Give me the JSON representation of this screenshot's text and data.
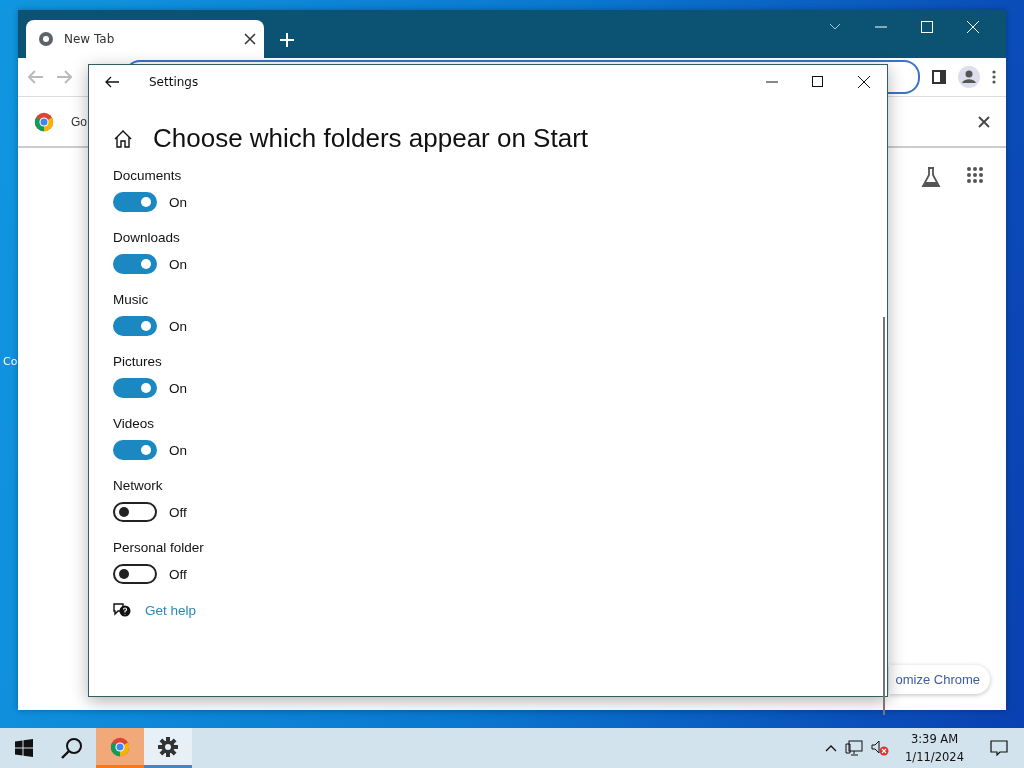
{
  "desktop": {
    "icon_label": "Co"
  },
  "browser": {
    "tabs": [
      {
        "title": "New Tab",
        "selected": true
      }
    ],
    "infobar_text": "Go",
    "customize_button": "omize Chrome"
  },
  "settings": {
    "title": "Settings",
    "heading": "Choose which folders appear on Start",
    "folders": [
      {
        "name": "Documents",
        "on": true,
        "state_label": "On"
      },
      {
        "name": "Downloads",
        "on": true,
        "state_label": "On"
      },
      {
        "name": "Music",
        "on": true,
        "state_label": "On"
      },
      {
        "name": "Pictures",
        "on": true,
        "state_label": "On"
      },
      {
        "name": "Videos",
        "on": true,
        "state_label": "On"
      },
      {
        "name": "Network",
        "on": false,
        "state_label": "Off"
      },
      {
        "name": "Personal folder",
        "on": false,
        "state_label": "Off"
      }
    ],
    "help_link": "Get help"
  },
  "taskbar": {
    "apps": [
      {
        "kind": "chrome",
        "selected": false,
        "flashing": true
      },
      {
        "kind": "settings",
        "selected": true,
        "flashing": false
      }
    ],
    "time": "3:39 AM",
    "date": "1/11/2024"
  }
}
